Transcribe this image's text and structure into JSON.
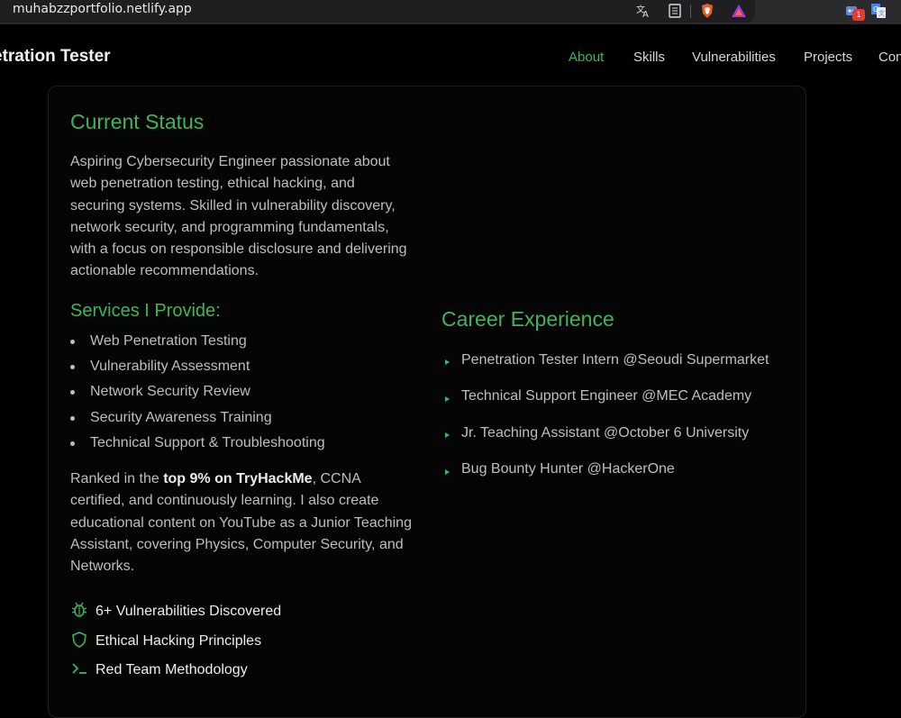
{
  "browser": {
    "url": "muhabzzportfolio.netlify.app",
    "badge_count": "1"
  },
  "nav": {
    "brand": "etration Tester",
    "links": [
      "About",
      "Skills",
      "Vulnerabilities",
      "Projects",
      "Con"
    ],
    "active_color": "#3fb45a"
  },
  "status": {
    "title": "Current Status",
    "lines": [
      "Aspiring Cybersecurity Engineer passionate about",
      "web penetration testing, ethical hacking, and",
      "securing systems. Skilled in vulnerability discovery,",
      "network security, and programming fundamentals,",
      "with a focus on responsible disclosure and delivering",
      "actionable recommendations."
    ]
  },
  "services": {
    "title": "Services I Provide:",
    "items": [
      "Web Penetration Testing",
      "Vulnerability Assessment",
      "Network Security Review",
      "Security Awareness Training",
      "Technical Support & Troubleshooting"
    ]
  },
  "ranked": {
    "line1_pre": "Ranked in the ",
    "line1_bold": "top 9% on TryHackMe",
    "line1_post": ", CCNA",
    "lines": [
      "certified, and continuously learning. I also create",
      "educational content on YouTube as a Junior Teaching",
      "Assistant, covering Physics, Computer Security, and",
      "Networks."
    ]
  },
  "features": [
    {
      "label": "6+ Vulnerabilities Discovered",
      "icon": "bug-icon"
    },
    {
      "label": "Ethical Hacking Principles",
      "icon": "shield-icon"
    },
    {
      "label": "Red Team Methodology",
      "icon": "terminal-icon"
    }
  ],
  "career": {
    "title": "Career Experience",
    "items": [
      "Penetration Tester Intern @Seoudi Supermarket",
      "Technical Support Engineer @MEC Academy",
      "Jr. Teaching Assistant @October 6 University",
      "Bug Bounty Hunter @HackerOne"
    ]
  }
}
